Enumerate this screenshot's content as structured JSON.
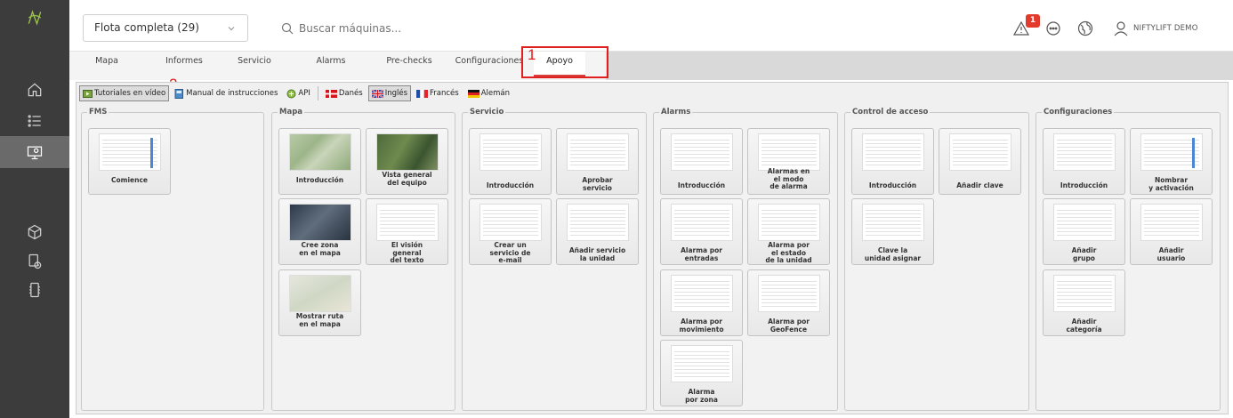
{
  "header": {
    "fleet_select": "Flota completa (29)",
    "search_placeholder": "Buscar máquinas...",
    "notification_count": "1",
    "user_name": "NIFTYLIFT DEMO"
  },
  "tabs": [
    "Mapa",
    "Informes",
    "Servicio",
    "Alarms",
    "Pre-checks",
    "Configuraciones",
    "Apoyo"
  ],
  "annotations": [
    "1",
    "2"
  ],
  "toolbar": {
    "video": "Tutoriales en vídeo",
    "manual": "Manual de instrucciones",
    "api": "API",
    "danish": "Danés",
    "english": "Inglés",
    "french": "Francés",
    "german": "Alemán"
  },
  "sections": {
    "fms": {
      "title": "FMS",
      "cards": [
        "Comience"
      ]
    },
    "mapa": {
      "title": "Mapa",
      "cards": [
        "Introducción",
        "Vista general\ndel equipo",
        "Cree zona\nen el mapa",
        "El visión\ngeneral\ndel texto",
        "Mostrar ruta\nen el mapa"
      ]
    },
    "servicio": {
      "title": "Servicio",
      "cards": [
        "Introducción",
        "Aprobar\nservicio",
        "Crear un\nservicio de\ne-mail",
        "Añadir servicio\nla unidad"
      ]
    },
    "alarms": {
      "title": "Alarms",
      "cards": [
        "Introducción",
        "Alarmas en\nel modo\nde alarma",
        "Alarma por\nentradas",
        "Alarma por\nel estado\nde la unidad",
        "Alarma por\nmovimiento",
        "Alarma por\nGeoFence",
        "Alarma\npor zona"
      ]
    },
    "control": {
      "title": "Control de acceso",
      "cards": [
        "Introducción",
        "Añadir clave",
        "Clave la\nunidad asignar"
      ]
    },
    "config": {
      "title": "Configuraciones",
      "cards": [
        "Introducción",
        "Nombrar\ny activación",
        "Añadir\ngrupo",
        "Añadir\nusuario",
        "Añadir\ncategoría"
      ]
    }
  }
}
